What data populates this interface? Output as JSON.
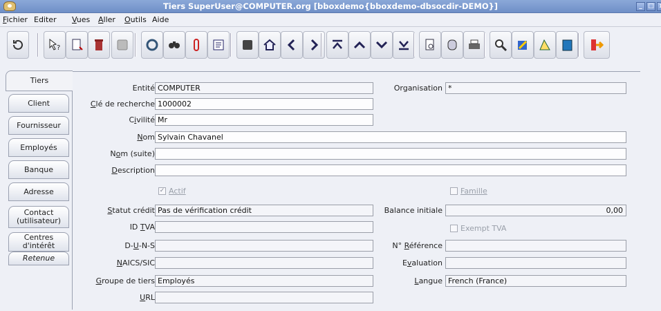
{
  "window": {
    "title": "Tiers  SuperUser@COMPUTER.org [bboxdemo{bboxdemo-dbsocdir-DEMO}]"
  },
  "menu": [
    {
      "label": "Fichier",
      "key": "F"
    },
    {
      "label": "Editer",
      "key": ""
    },
    {
      "label": "Vues",
      "key": "V"
    },
    {
      "label": "Aller",
      "key": "A"
    },
    {
      "label": "Outils",
      "key": "O"
    },
    {
      "label": "Aide",
      "key": ""
    }
  ],
  "toolbar": {
    "icons": [
      "undo-icon",
      "help-pointer-icon",
      "new-record-icon",
      "delete-icon",
      "save-icon",
      "refresh-icon",
      "find-icon",
      "attachment-icon",
      "report-icon",
      "history-icon",
      "home-icon",
      "previous-icon",
      "next-icon",
      "first-icon",
      "previous-record-icon",
      "next-record-icon",
      "last-icon",
      "print-preview-icon",
      "archive-icon",
      "print-icon",
      "zoom-icon",
      "workflow-icon",
      "product-icon",
      "info-icon",
      "exit-icon"
    ]
  },
  "tabs": [
    {
      "label": "Tiers"
    },
    {
      "label": "Client"
    },
    {
      "label": "Fournisseur"
    },
    {
      "label": "Employés"
    },
    {
      "label": "Banque"
    },
    {
      "label": "Adresse"
    },
    {
      "label": "Contact (utilisateur)"
    },
    {
      "label": "Centres d'intérêt"
    },
    {
      "label": "Retenue"
    }
  ],
  "form": {
    "entite": {
      "label": "Entité",
      "value": "COMPUTER"
    },
    "organisation": {
      "label": "Organisation",
      "value": "*"
    },
    "cle": {
      "label": "Clé de recherche",
      "value": "1000002"
    },
    "civilite": {
      "label": "Civilité",
      "value": "Mr"
    },
    "nom": {
      "label": "Nom",
      "value": "Sylvain Chavanel"
    },
    "nom_suite": {
      "label": "Nom (suite)",
      "value": ""
    },
    "description": {
      "label": "Description",
      "value": ""
    },
    "actif": {
      "label": "Actif",
      "checked": true
    },
    "famille": {
      "label": "Famille",
      "checked": false
    },
    "statut_credit": {
      "label": "Statut crédit",
      "value": "Pas de vérification crédit"
    },
    "balance": {
      "label": "Balance initiale",
      "value": "0,00"
    },
    "id_tva": {
      "label": "ID TVA",
      "value": ""
    },
    "exempt_tva": {
      "label": "Exempt TVA",
      "checked": false
    },
    "duns": {
      "label": "D-U-N-S",
      "value": ""
    },
    "reference": {
      "label": "N° Référence",
      "value": ""
    },
    "naics": {
      "label": "NAICS/SIC",
      "value": ""
    },
    "evaluation": {
      "label": "Evaluation",
      "value": ""
    },
    "groupe": {
      "label": "Groupe de tiers",
      "value": "Employés"
    },
    "langue": {
      "label": "Langue",
      "value": "French (France)"
    },
    "url": {
      "label": "URL",
      "value": ""
    }
  }
}
